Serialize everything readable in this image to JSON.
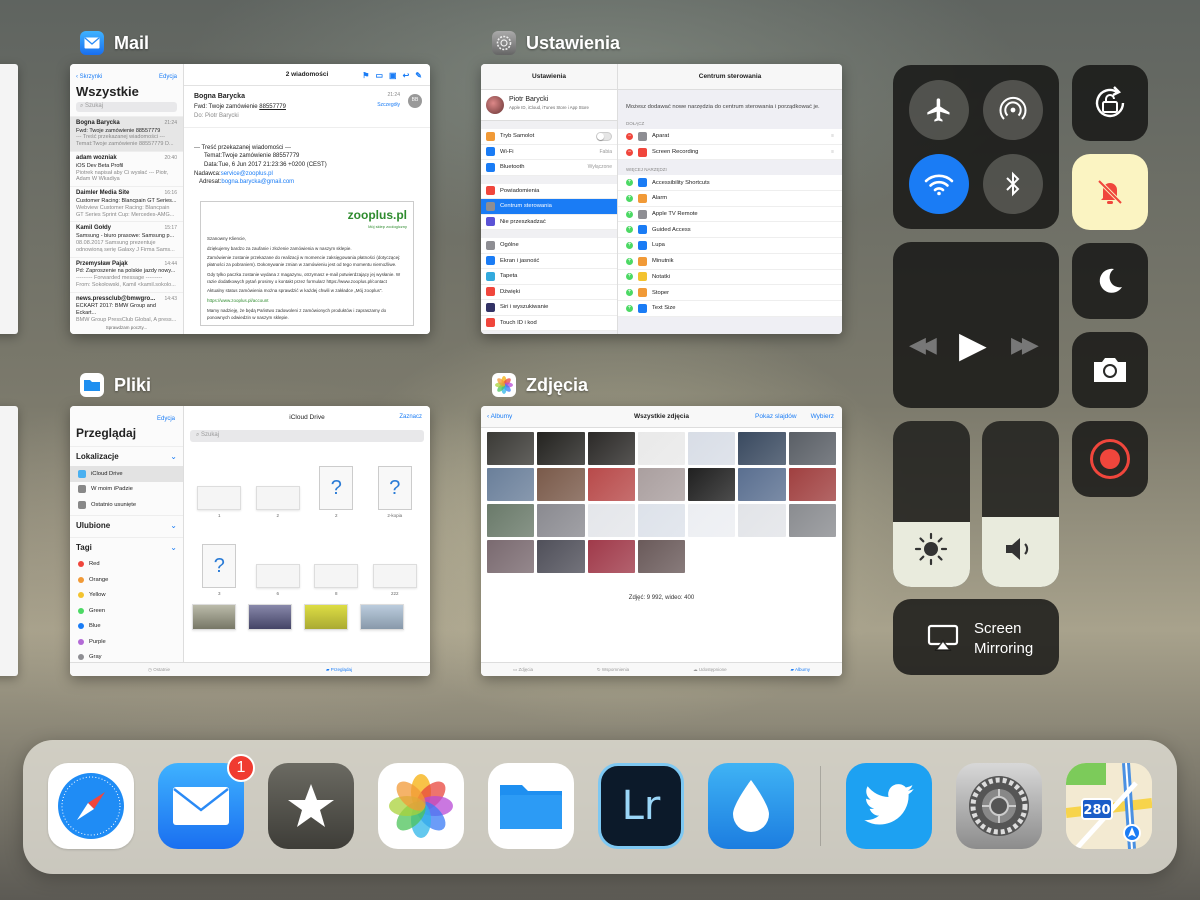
{
  "mail": {
    "app_label": "Mail",
    "back": "Skrzynki",
    "edit": "Edycja",
    "list_title": "Wszystkie",
    "search_placeholder": "Szukaj",
    "items": [
      {
        "from": "Bogna Barycka",
        "time": "21:24",
        "subject": "Fwd: Twoje zamówienie 88557779",
        "preview": "--- Treść przekazanej wiadomości --- Temat:Twoje zamówienie 88557779 D..."
      },
      {
        "from": "adam wozniak",
        "time": "20:40",
        "subject": "iOS Dev Beta Profil",
        "preview": "Piotrek napisał aby Ci wysłać --- Piotr, Adam W Wkadiya"
      },
      {
        "from": "Daimler Media Site",
        "time": "16:16",
        "subject": "Customer Racing: Blancpain GT Series...",
        "preview": "Webview Customer Racing: Blancpain GT Series Sprint Cup: Mercedes-AMG..."
      },
      {
        "from": "Kamil Gołdy",
        "time": "15:17",
        "subject": "Samsung - biuro prasowe: Samsung p...",
        "preview": "08.08.2017 Samsung prezentuje odnowioną serię Galaxy J Firma Sams..."
      },
      {
        "from": "Przemysław Pająk",
        "time": "14:44",
        "subject": "Pd: Zaproszenie na polskie jazdy nowy...",
        "preview": "--------- Forwarded message --------- From: Sokołowski, Kamil <kamil.sokolo..."
      },
      {
        "from": "news.pressclub@bmwgro...",
        "time": "14:43",
        "subject": "ECKART 2017: BMW Group and Eckart...",
        "preview": "BMW Group PressClub Global, A press..."
      }
    ],
    "footer_status": "Sprawdzam poczty...",
    "msg_count": "2 wiadomości",
    "sender": "Bogna Barycka",
    "sender_time": "21:24",
    "fwd_label": "Fwd: Twoje zamówienie",
    "fwd_number": "88557779",
    "to_label": "Do:",
    "to_name": "Piotr Barycki",
    "details": "Szczegóły",
    "avatar_initials": "BB",
    "body_header": "--- Treść przekazanej wiadomości ---",
    "body_topic": "Temat:Twoje zamówienie 88557779",
    "body_date": "Data:Tue, 6 Jun 2017 21:23:36 +0200 (CEST)",
    "body_sender_label": "Nadawca:",
    "body_sender": "service@zooplus.pl",
    "body_address_label": "Adresat:",
    "body_address": "bogna.barycka@gmail.com",
    "embed_logo": "zooplus.pl",
    "embed_tagline": "Mój sklep zoologiczny",
    "embed_greeting": "Szanowny Kliencie,",
    "embed_p1": "dziękujemy bardzo za zaufanie i złożenie zamówienia w naszym sklepie.",
    "embed_p2": "Zamówienie zostanie przekazane do realizacji w momencie zaksięgowania płatności (dotyczącej: płatności za pobraniem). Dokonywanie zmian w zamówieniu jest od tego momentu niemożliwe.",
    "embed_p3": "Gdy tylko paczka zostanie wydana z magazynu, otrzymasz e-mail potwierdzający jej wysłanie. W razie dodatkowych pytań prosimy o kontakt przez formularz https://www.zooplus.pl/contact",
    "embed_p4": "Aktualny status zamówienia można sprawdzić w każdej chwili w zakładce „Mój zooplus\".",
    "embed_link": "https://www.zooplus.pl/account",
    "embed_p5": "Mamy nadzieję, że będą Państwo zadowoleni z zamówionych produktów i zapraszamy do ponownych odwiedzin w naszym sklepie."
  },
  "settings": {
    "app_label": "Ustawienia",
    "left_title": "Ustawienia",
    "right_title": "Centrum sterowania",
    "profile_name": "Piotr Barycki",
    "profile_sub": "Apple ID, iCloud, iTunes Store i App Store",
    "rows1": [
      {
        "label": "Tryb Samolot",
        "value": "",
        "color": "#f19a37"
      },
      {
        "label": "Wi-Fi",
        "value": "Fabia",
        "color": "#1a7cf5"
      },
      {
        "label": "Bluetooth",
        "value": "Wyłączone",
        "color": "#1a7cf5"
      }
    ],
    "rows2": [
      {
        "label": "Powiadomienia",
        "color": "#f0463c"
      },
      {
        "label": "Centrum sterowania",
        "color": "#8e8e93"
      },
      {
        "label": "Nie przeszkadzać",
        "color": "#5b53d6"
      }
    ],
    "rows3": [
      {
        "label": "Ogólne",
        "color": "#8e8e93"
      },
      {
        "label": "Ekran i jasność",
        "color": "#1a7cf5"
      },
      {
        "label": "Tapeta",
        "color": "#33aadd"
      },
      {
        "label": "Dźwięki",
        "color": "#f0463c"
      },
      {
        "label": "Siri i wyszukiwanie",
        "color": "#333366"
      },
      {
        "label": "Touch ID i kod",
        "color": "#f0463c"
      }
    ],
    "right_desc": "Możesz dodawać nowe narzędzia do centrum sterowania i porządkować je.",
    "included_head": "DOŁĄCZ",
    "included": [
      {
        "label": "Aparat",
        "color": "#8e8e93"
      },
      {
        "label": "Screen Recording",
        "color": "#f0463c"
      }
    ],
    "more_head": "WIĘCEJ NARZĘDZI",
    "more": [
      {
        "label": "Accessibility Shortcuts",
        "color": "#1a7cf5"
      },
      {
        "label": "Alarm",
        "color": "#f19a37"
      },
      {
        "label": "Apple TV Remote",
        "color": "#8e8e93"
      },
      {
        "label": "Guided Access",
        "color": "#1a7cf5"
      },
      {
        "label": "Lupa",
        "color": "#1a7cf5"
      },
      {
        "label": "Minutnik",
        "color": "#f19a37"
      },
      {
        "label": "Notatki",
        "color": "#f3c32f"
      },
      {
        "label": "Stoper",
        "color": "#f19a37"
      },
      {
        "label": "Text Size",
        "color": "#1a7cf5"
      }
    ]
  },
  "files": {
    "app_label": "Pliki",
    "edit": "Edycja",
    "title": "Przeglądaj",
    "sec_locations": "Lokalizacje",
    "locations": [
      "iCloud Drive",
      "W moim iPadzie",
      "Ostatnio usunięte"
    ],
    "sec_favorites": "Ulubione",
    "sec_tags": "Tagi",
    "tags": [
      {
        "label": "Red",
        "color": "#f0463c"
      },
      {
        "label": "Orange",
        "color": "#f19a37"
      },
      {
        "label": "Yellow",
        "color": "#f3c32f"
      },
      {
        "label": "Green",
        "color": "#4cd964"
      },
      {
        "label": "Blue",
        "color": "#1a7cf5"
      },
      {
        "label": "Purple",
        "color": "#b36ad6"
      },
      {
        "label": "Gray",
        "color": "#8e8e93"
      }
    ],
    "header": "iCloud Drive",
    "select": "Zaznacz",
    "search_placeholder": "Szukaj",
    "file_names": [
      "1",
      "2",
      "2",
      "2-kopia",
      "3",
      "6",
      "8",
      "222"
    ],
    "tab_recent": "Ostatnie",
    "tab_browse": "Przeglądaj"
  },
  "photos": {
    "app_label": "Zdjęcia",
    "back": "Albumy",
    "title": "Wszystkie zdjęcia",
    "slideshow": "Pokaz slajdów",
    "select": "Wybierz",
    "count": "Zdjęć: 9 992, wideo: 400",
    "tabs": [
      "Zdjęcia",
      "Wspomnienia",
      "Udostępnione",
      "Albumy"
    ]
  },
  "control_center": {
    "screen_mirroring_line1": "Screen",
    "screen_mirroring_line2": "Mirroring",
    "brightness_level": 0.39,
    "volume_level": 0.42,
    "colors": {
      "wifi_on": "#1a7cf5",
      "mute_on": "#fbf4c2",
      "record": "#f0463c"
    }
  },
  "dock": {
    "mail_badge": "1",
    "lightroom_label": "Lr",
    "maps_shield": "280",
    "apps": [
      "safari-icon",
      "mail-icon",
      "reeder-icon",
      "photos-icon",
      "files-icon",
      "lightroom-icon",
      "drop-icon",
      "twitter-icon",
      "settings-icon",
      "maps-icon"
    ]
  }
}
